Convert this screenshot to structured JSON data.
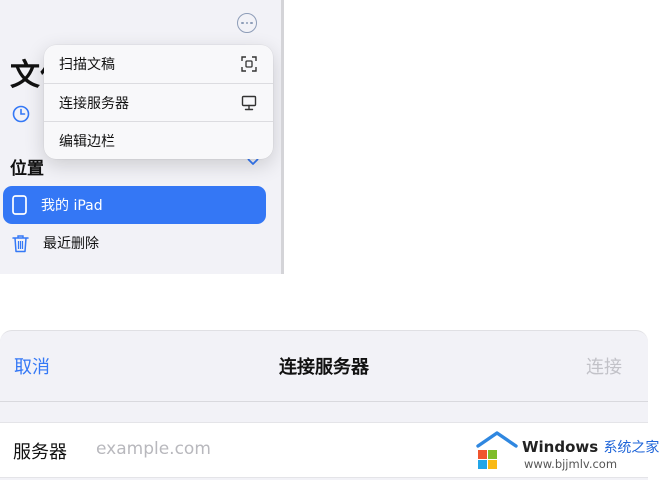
{
  "sidebar": {
    "title": "文件",
    "locations_header": "位置",
    "items": [
      {
        "label": "我的 iPad",
        "selected": true
      },
      {
        "label": "最近删除",
        "selected": false
      }
    ]
  },
  "menu": {
    "items": [
      {
        "label": "扫描文稿",
        "icon": "scan-icon"
      },
      {
        "label": "连接服务器",
        "icon": "monitor-icon"
      },
      {
        "label": "编辑边栏",
        "icon": ""
      }
    ]
  },
  "sheet": {
    "cancel": "取消",
    "title": "连接服务器",
    "connect": "连接",
    "server_label": "服务器",
    "server_placeholder": "example.com",
    "server_value": ""
  },
  "watermark": {
    "brand": "Windows",
    "brand_cn": "系统之家",
    "url": "www.bjjmlv.com"
  },
  "colors": {
    "accent": "#3478f6",
    "selected_row": "#3477f5",
    "sidebar_bg": "#f2f2f7",
    "disabled": "#c2c2c8"
  }
}
